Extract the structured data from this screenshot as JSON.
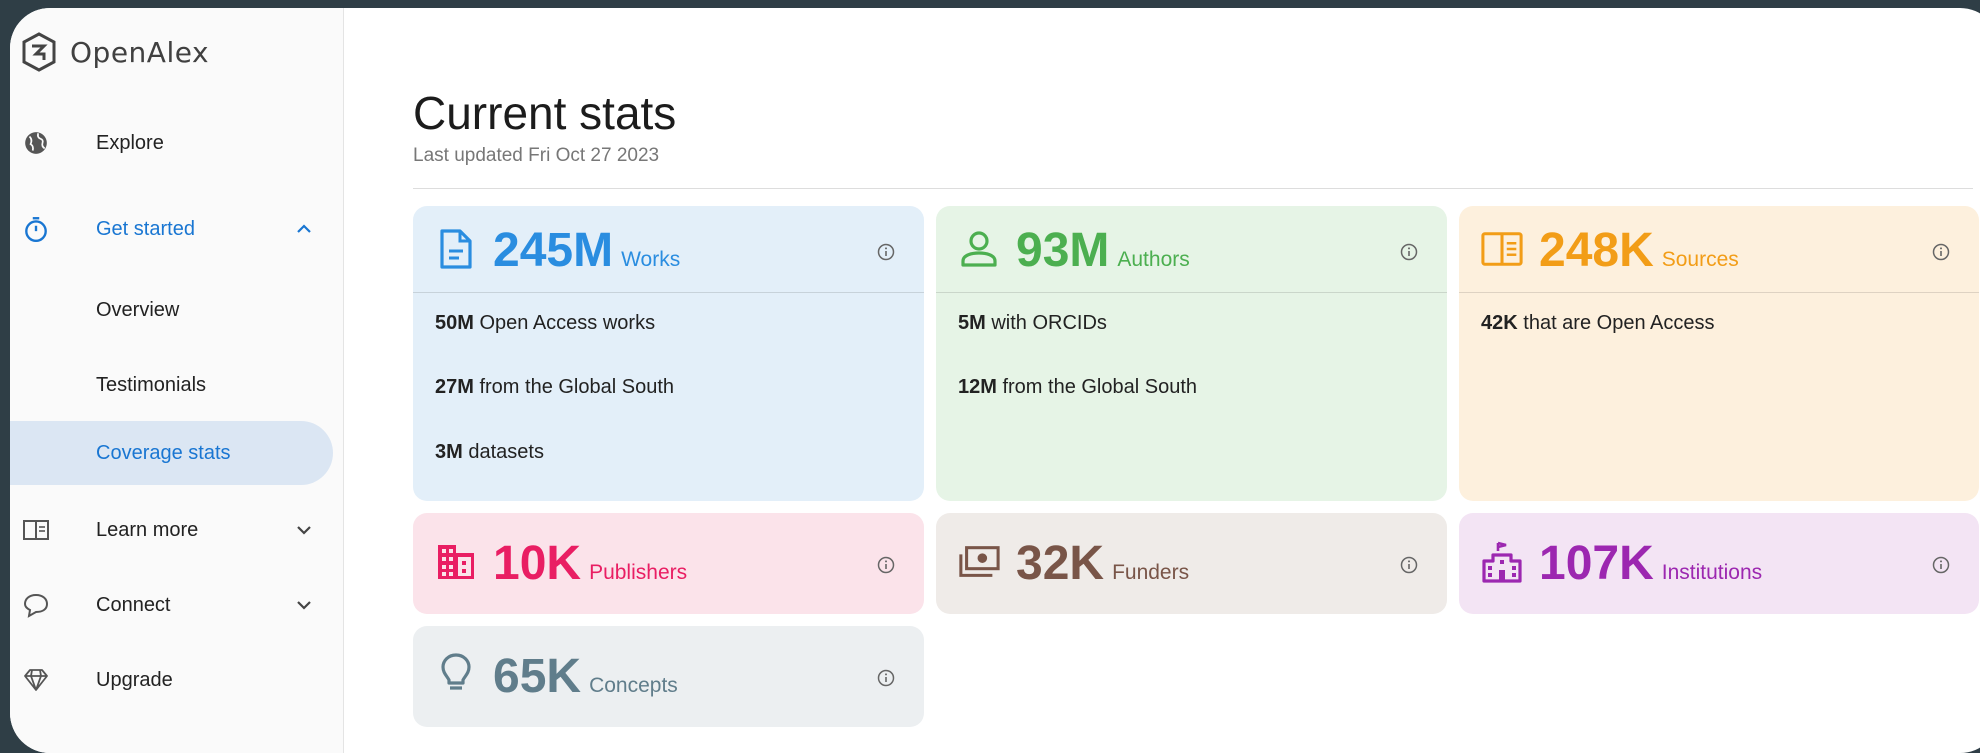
{
  "app": {
    "name": "OpenAlex"
  },
  "sidebar": {
    "items": [
      {
        "label": "Explore"
      },
      {
        "label": "Get started"
      },
      {
        "label": "Overview"
      },
      {
        "label": "Testimonials"
      },
      {
        "label": "Coverage stats"
      },
      {
        "label": "Learn more"
      },
      {
        "label": "Connect"
      },
      {
        "label": "Upgrade"
      }
    ]
  },
  "main": {
    "title": "Current stats",
    "updated": "Last updated Fri Oct 27 2023"
  },
  "colors": {
    "works": "#2a8de0",
    "authors": "#4caf50",
    "sources": "#f29d17",
    "publishers": "#e91e63",
    "funders": "#795548",
    "institutions": "#9c27b0",
    "concepts": "#607d8b",
    "accent": "#1976d2"
  },
  "cards": {
    "works": {
      "count": "245M",
      "label": "Works",
      "icon": "document-icon",
      "rows": [
        {
          "value": "50M",
          "text": " Open Access works"
        },
        {
          "value": "27M",
          "text": " from the Global South"
        },
        {
          "value": "3M",
          "text": " datasets"
        }
      ]
    },
    "authors": {
      "count": "93M",
      "label": "Authors",
      "icon": "person-icon",
      "rows": [
        {
          "value": "5M",
          "text": " with ORCIDs"
        },
        {
          "value": "12M",
          "text": " from the Global South"
        }
      ]
    },
    "sources": {
      "count": "248K",
      "label": "Sources",
      "icon": "book-icon",
      "rows": [
        {
          "value": "42K",
          "text": " that are Open Access"
        }
      ]
    },
    "publishers": {
      "count": "10K",
      "label": "Publishers",
      "icon": "building-icon"
    },
    "funders": {
      "count": "32K",
      "label": "Funders",
      "icon": "money-icon"
    },
    "institutions": {
      "count": "107K",
      "label": "Institutions",
      "icon": "institution-icon"
    },
    "concepts": {
      "count": "65K",
      "label": "Concepts",
      "icon": "lightbulb-icon"
    }
  }
}
